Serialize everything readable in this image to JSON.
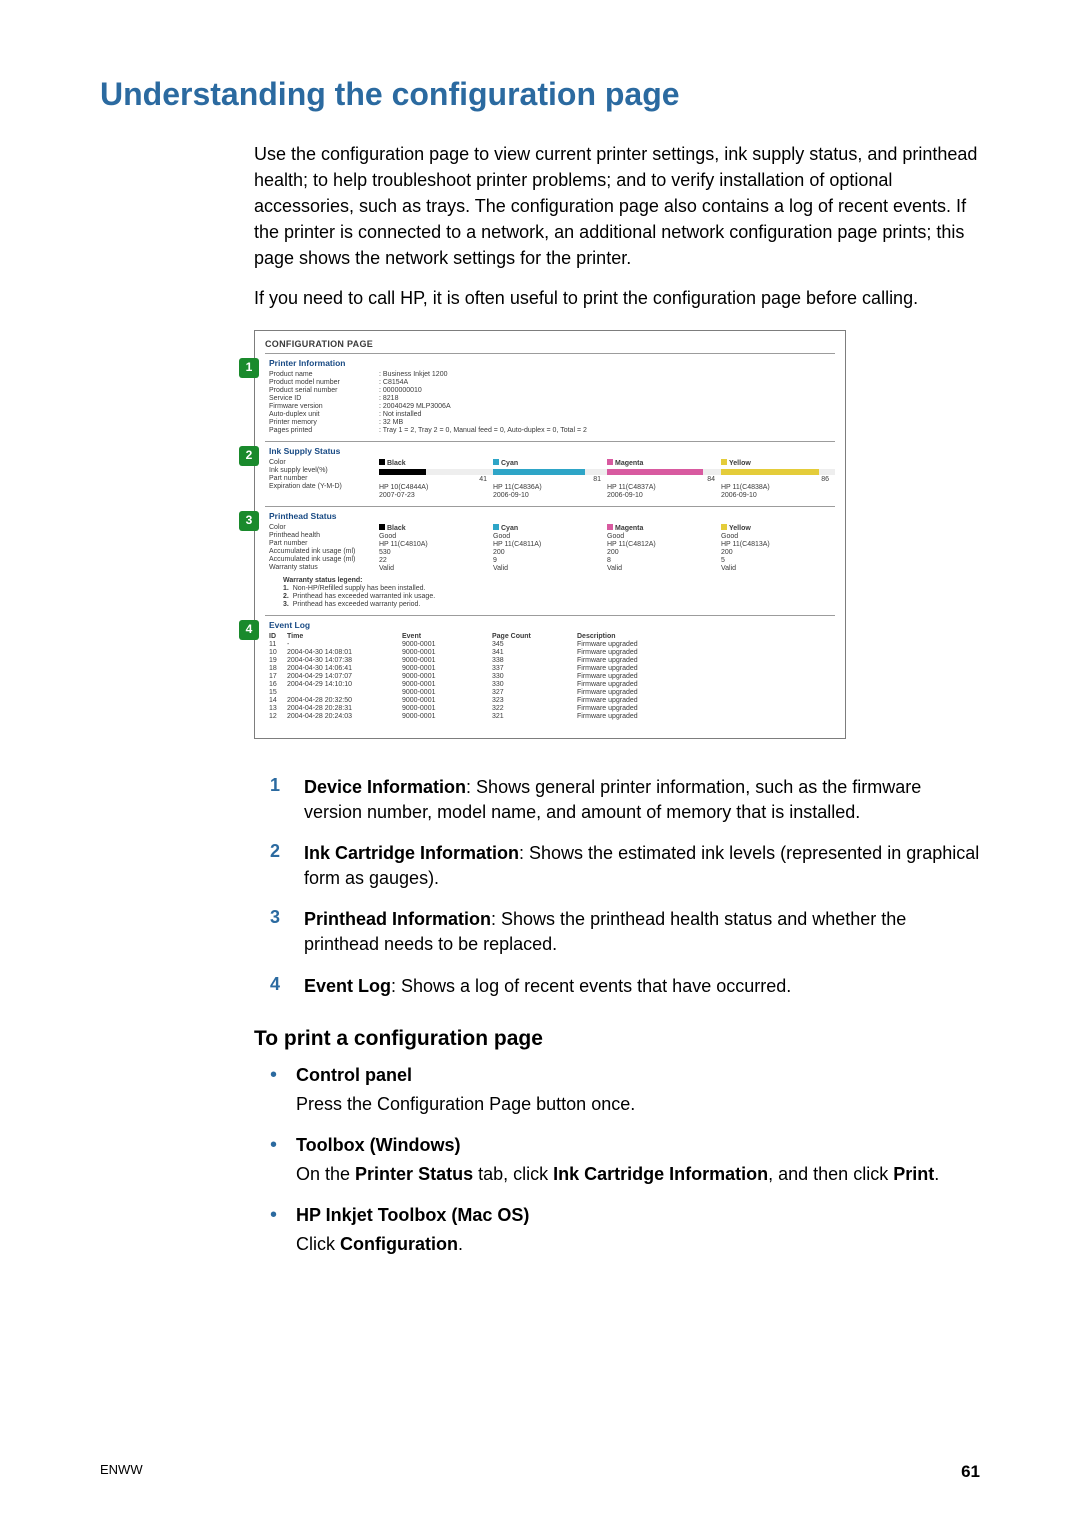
{
  "title": "Understanding the configuration page",
  "intro1": "Use the configuration page to view current printer settings, ink supply status, and printhead health; to help troubleshoot printer problems; and to verify installation of optional accessories, such as trays. The configuration page also contains a log of recent events. If the printer is connected to a network, an additional network configuration page prints; this page shows the network settings for the printer.",
  "intro2": "If you need to call HP, it is often useful to print the configuration page before calling.",
  "mock": {
    "title": "CONFIGURATION PAGE",
    "printerInfo": {
      "badge": "1",
      "heading": "Printer Information",
      "rows": [
        [
          "Product name",
          "Business Inkjet 1200"
        ],
        [
          "Product model number",
          "C8154A"
        ],
        [
          "Product serial number",
          "0000000010"
        ],
        [
          "Service ID",
          "8218"
        ],
        [
          "Firmware version",
          "20040429 MLP3006A"
        ],
        [
          "Auto-duplex unit",
          "Not installed"
        ],
        [
          "Printer memory",
          "32 MB"
        ],
        [
          "Pages printed",
          "Tray 1 = 2, Tray 2 = 0, Manual feed = 0, Auto-duplex = 0, Total = 2"
        ]
      ]
    },
    "inkSupply": {
      "badge": "2",
      "heading": "Ink Supply Status",
      "labels": [
        "Color",
        "Ink supply level(%)",
        "Part number",
        "Expiration date (Y-M-D)"
      ],
      "cols": [
        {
          "name": "Black",
          "level": 41,
          "part": "HP 10(C4844A)",
          "exp": "2007-07-23",
          "color": "#000"
        },
        {
          "name": "Cyan",
          "level": 81,
          "part": "HP 11(C4836A)",
          "exp": "2006-09-10",
          "color": "#2ea5c7"
        },
        {
          "name": "Magenta",
          "level": 84,
          "part": "HP 11(C4837A)",
          "exp": "2006-09-10",
          "color": "#d85aa0"
        },
        {
          "name": "Yellow",
          "level": 86,
          "part": "HP 11(C4838A)",
          "exp": "2006-09-10",
          "color": "#e4cc3a"
        }
      ]
    },
    "printhead": {
      "badge": "3",
      "heading": "Printhead Status",
      "labels": [
        "Color",
        "Printhead health",
        "Part number",
        "Accumulated ink usage (ml)",
        "Accumulated ink usage (ml)",
        "Warranty status"
      ],
      "cols": [
        {
          "name": "Black",
          "health": "Good",
          "part": "HP 11(C4810A)",
          "u1": "530",
          "u2": "22",
          "warr": "Valid",
          "color": "#000"
        },
        {
          "name": "Cyan",
          "health": "Good",
          "part": "HP 11(C4811A)",
          "u1": "200",
          "u2": "9",
          "warr": "Valid",
          "color": "#2ea5c7"
        },
        {
          "name": "Magenta",
          "health": "Good",
          "part": "HP 11(C4812A)",
          "u1": "200",
          "u2": "8",
          "warr": "Valid",
          "color": "#d85aa0"
        },
        {
          "name": "Yellow",
          "health": "Good",
          "part": "HP 11(C4813A)",
          "u1": "200",
          "u2": "5",
          "warr": "Valid",
          "color": "#e4cc3a"
        }
      ],
      "legendTitle": "Warranty status legend:",
      "legend": [
        "Non-HP/Refilled supply has been installed.",
        "Printhead has exceeded warranted ink usage.",
        "Printhead has exceeded warranty period."
      ]
    },
    "eventLog": {
      "badge": "4",
      "heading": "Event Log",
      "headers": [
        "ID",
        "Time",
        "Event",
        "Page Count",
        "Description"
      ],
      "rows": [
        [
          "11",
          "-",
          "9000-0001",
          "345",
          "Firmware upgraded"
        ],
        [
          "10",
          "2004-04-30  14:08:01",
          "9000-0001",
          "341",
          "Firmware upgraded"
        ],
        [
          "19",
          "2004-04-30  14:07:38",
          "9000-0001",
          "338",
          "Firmware upgraded"
        ],
        [
          "18",
          "2004-04-30  14:06:41",
          "9000-0001",
          "337",
          "Firmware upgraded"
        ],
        [
          "17",
          "2004-04-29  14:07:07",
          "9000-0001",
          "330",
          "Firmware upgraded"
        ],
        [
          "16",
          "2004-04-29  14:10:10",
          "9000-0001",
          "330",
          "Firmware upgraded"
        ],
        [
          "15",
          "",
          "9000-0001",
          "327",
          "Firmware upgraded"
        ],
        [
          "14",
          "2004-04-28  20:32:50",
          "9000-0001",
          "323",
          "Firmware upgraded"
        ],
        [
          "13",
          "2004-04-28  20:28:31",
          "9000-0001",
          "322",
          "Firmware upgraded"
        ],
        [
          "12",
          "2004-04-28  20:24:03",
          "9000-0001",
          "321",
          "Firmware upgraded"
        ]
      ]
    }
  },
  "legend": [
    {
      "n": "1",
      "head": "Device Information",
      "text": ": Shows general printer information, such as the firmware version number, model name, and amount of memory that is installed."
    },
    {
      "n": "2",
      "head": "Ink Cartridge Information",
      "text": ": Shows the estimated ink levels (represented in graphical form as gauges)."
    },
    {
      "n": "3",
      "head": "Printhead Information",
      "text": ": Shows the printhead health status and whether the printhead needs to be replaced."
    },
    {
      "n": "4",
      "head": "Event Log",
      "text": ": Shows a log of recent events that have occurred."
    }
  ],
  "subheading": "To print a configuration page",
  "bullets": [
    {
      "head": "Control panel",
      "body_plain": "Press the Configuration Page button once."
    },
    {
      "head": "Toolbox (Windows)",
      "body_pre": "On the ",
      "b1": "Printer Status",
      "body_mid": " tab, click ",
      "b2": "Ink Cartridge Information",
      "body_mid2": ", and then click ",
      "b3": "Print",
      "body_post": "."
    },
    {
      "head": "HP Inkjet Toolbox (Mac OS)",
      "body_pre": "Click ",
      "b1": "Configuration",
      "body_post": "."
    }
  ],
  "footer_left": "ENWW",
  "footer_right": "61"
}
